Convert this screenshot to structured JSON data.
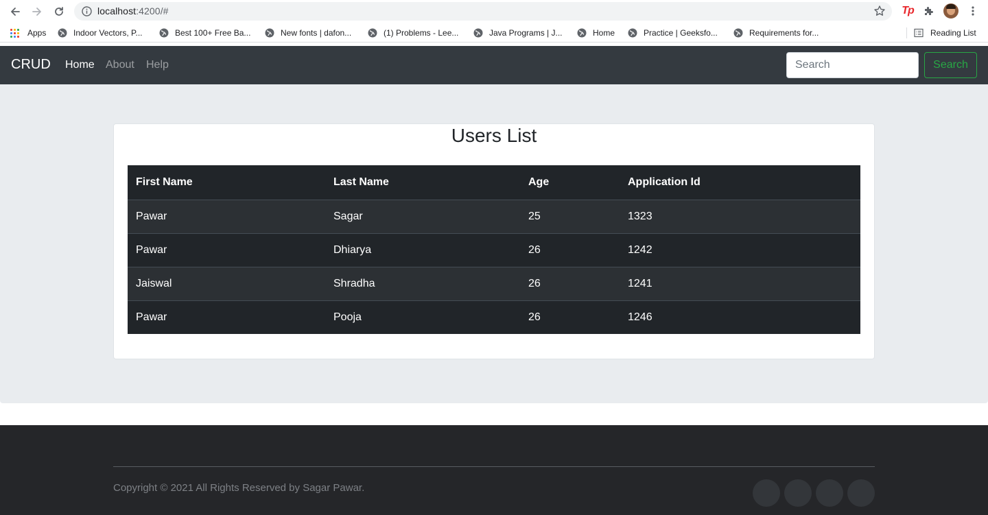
{
  "browser": {
    "url_host": "localhost",
    "url_rest": ":4200/#",
    "bookmarks": [
      {
        "label": "Apps",
        "icon": "apps-grid-icon"
      },
      {
        "label": "Indoor Vectors, P...",
        "icon": "globe-icon"
      },
      {
        "label": "Best 100+ Free Ba...",
        "icon": "globe-icon"
      },
      {
        "label": "New fonts | dafon...",
        "icon": "globe-icon"
      },
      {
        "label": "(1) Problems - Lee...",
        "icon": "globe-icon"
      },
      {
        "label": "Java Programs | J...",
        "icon": "globe-icon"
      },
      {
        "label": "Home",
        "icon": "globe-icon"
      },
      {
        "label": "Practice | Geeksfo...",
        "icon": "globe-icon"
      },
      {
        "label": "Requirements for...",
        "icon": "globe-icon"
      }
    ],
    "reading_list": "Reading List",
    "extension_label": "Tp"
  },
  "navbar": {
    "brand": "CRUD",
    "links": [
      {
        "label": "Home",
        "active": true
      },
      {
        "label": "About",
        "active": false
      },
      {
        "label": "Help",
        "active": false
      }
    ],
    "search_placeholder": "Search",
    "search_button": "Search"
  },
  "main": {
    "title": "Users List",
    "table": {
      "headers": [
        "First Name",
        "Last Name",
        "Age",
        "Application Id"
      ],
      "rows": [
        [
          "Pawar",
          "Sagar",
          "25",
          "1323"
        ],
        [
          "Pawar",
          "Dhiarya",
          "26",
          "1242"
        ],
        [
          "Jaiswal",
          "Shradha",
          "26",
          "1241"
        ],
        [
          "Pawar",
          "Pooja",
          "26",
          "1246"
        ]
      ]
    }
  },
  "footer": {
    "copyright": "Copyright © 2021 All Rights Reserved by Sagar Pawar."
  },
  "colors": {
    "navbar_bg": "#343a40",
    "page_bg": "#e9ecef",
    "table_dark": "#212529",
    "table_stripe": "#2c3034",
    "success": "#28a745",
    "footer_bg": "#252629"
  }
}
